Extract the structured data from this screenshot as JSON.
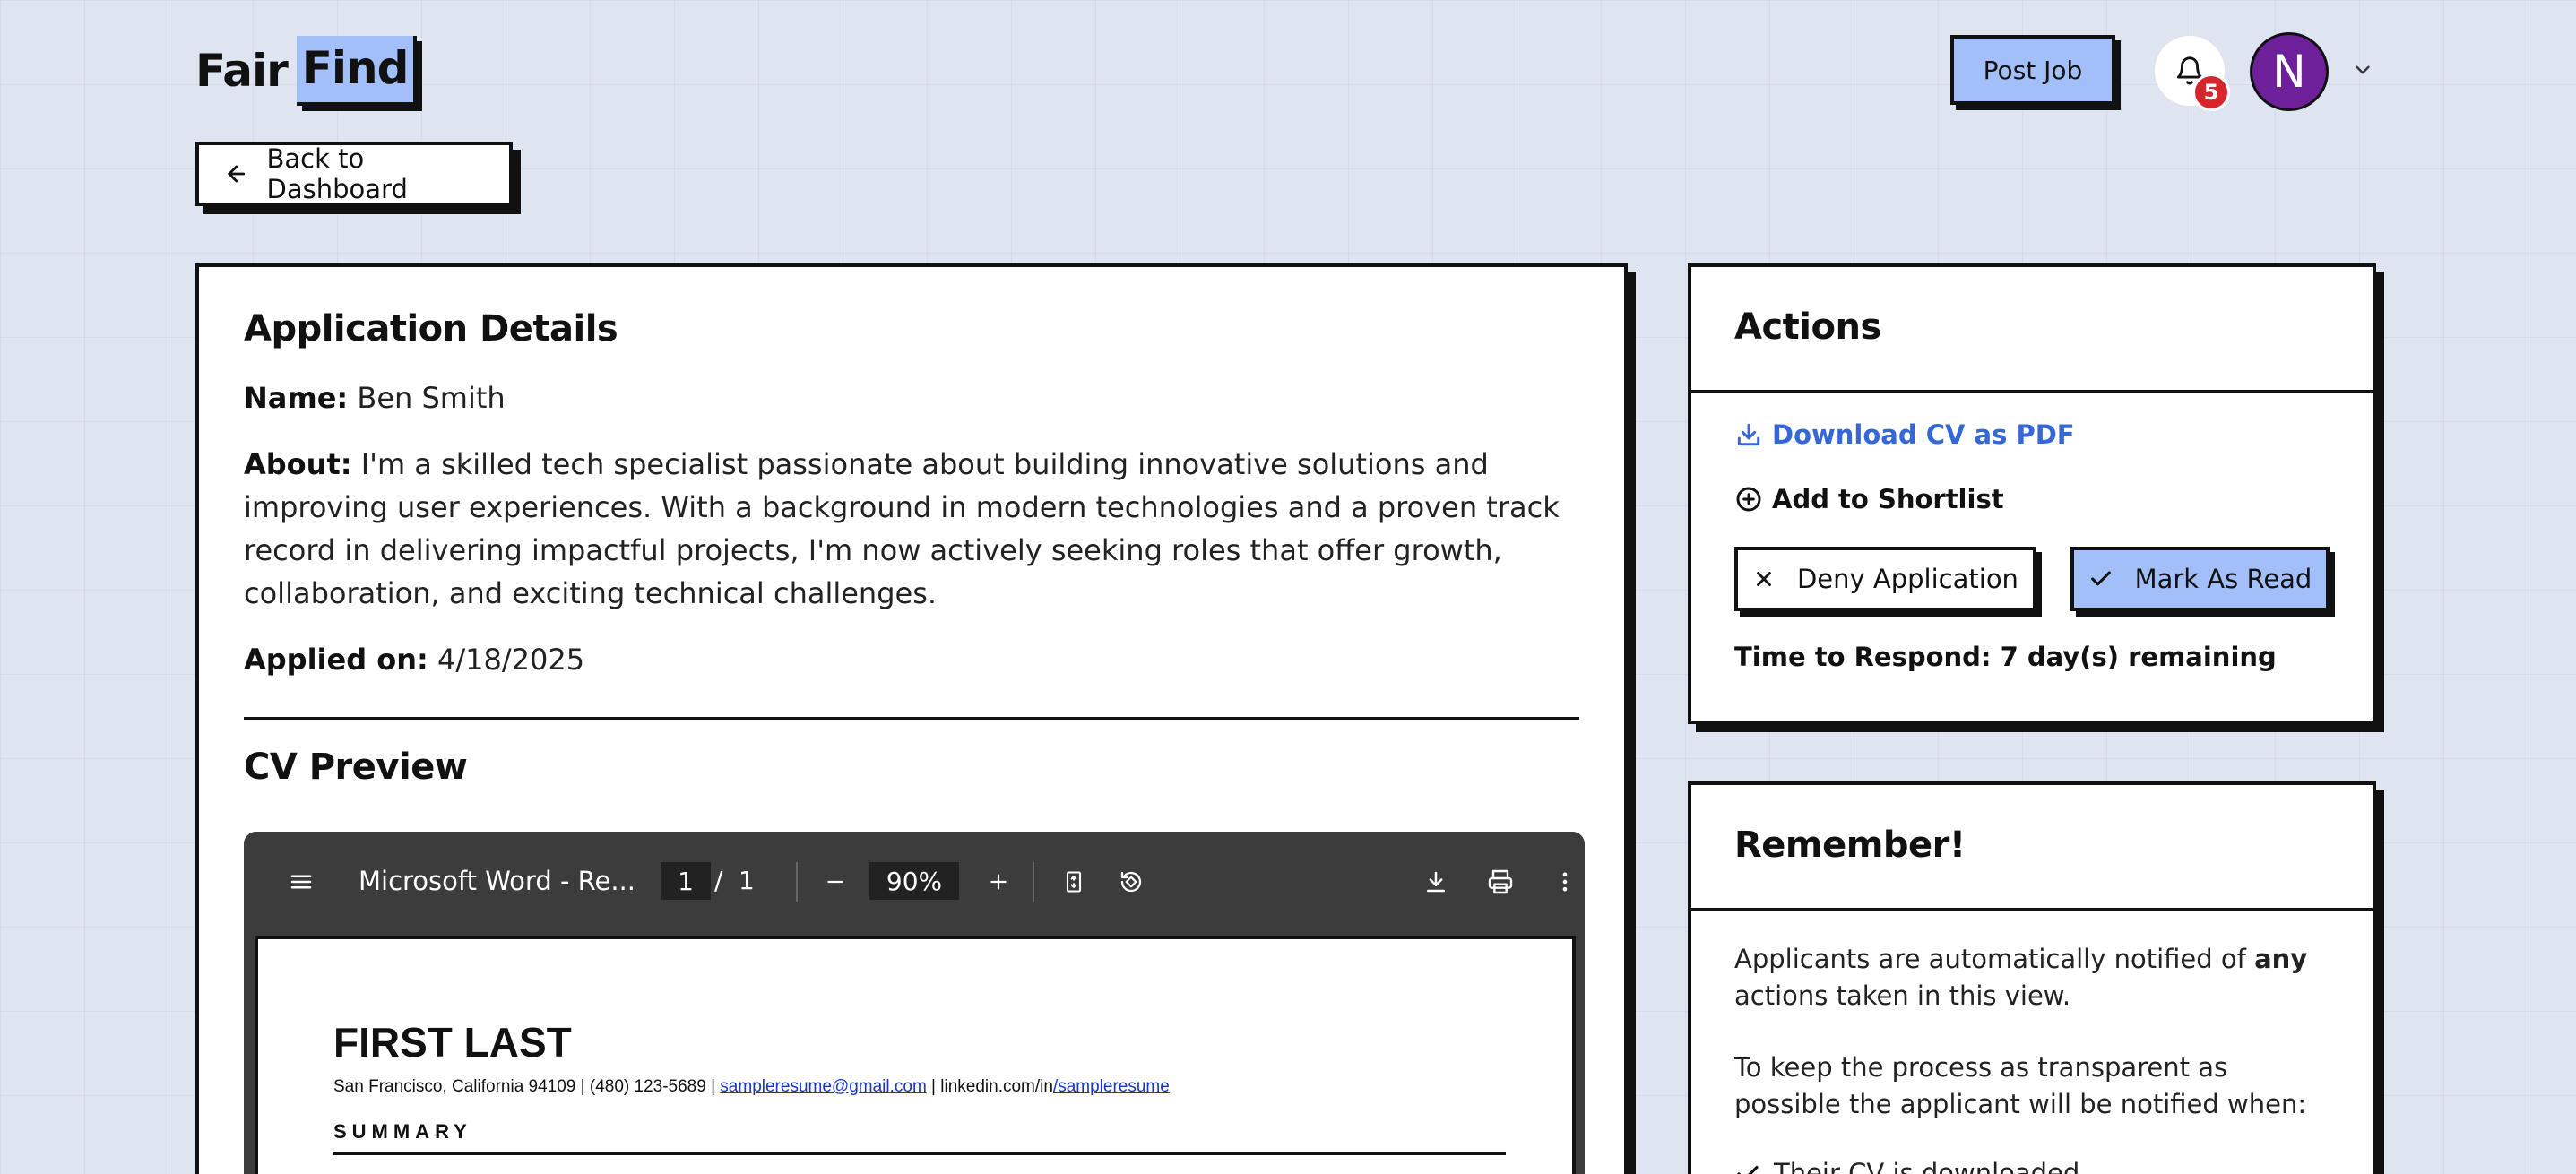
{
  "header": {
    "logo_part1": "Fair",
    "logo_part2": "Find",
    "post_job_label": "Post Job",
    "notification_count": "5",
    "avatar_initial": "N"
  },
  "back_button": {
    "label": "Back to Dashboard"
  },
  "application": {
    "title": "Application Details",
    "name_label": "Name:",
    "name_value": "Ben Smith",
    "about_label": "About:",
    "about_value": "I'm a skilled tech specialist passionate about building innovative solutions and improving user experiences. With a background in modern technologies and a proven track record in delivering impactful projects, I'm now actively seeking roles that offer growth, collaboration, and exciting technical challenges.",
    "applied_label": "Applied on:",
    "applied_value": "4/18/2025",
    "cv_preview_title": "CV Preview"
  },
  "pdf_viewer": {
    "doc_title": "Microsoft Word - Re...",
    "current_page": "1",
    "page_separator": "/",
    "total_pages": "1",
    "zoom": "90%",
    "resume": {
      "name": "FIRST LAST",
      "contact_prefix": "San Francisco, California 94109 | (480) 123-5689 |",
      "email": "sampleresume@gmail.com",
      "linkedin_prefix": "| linkedin.com/in",
      "linkedin_link": "/sampleresume",
      "section": "SUMMARY"
    }
  },
  "actions": {
    "title": "Actions",
    "download_label": "Download CV as PDF",
    "shortlist_label": "Add to Shortlist",
    "deny_label": "Deny Application",
    "mark_read_label": "Mark As Read",
    "time_to_respond": "Time to Respond: 7 day(s) remaining"
  },
  "remember": {
    "title": "Remember!",
    "p1_before": "Applicants are automatically notified of",
    "p1_bold": "any",
    "p1_after": "actions taken in this view.",
    "p2": "To keep the process as transparent as possible the applicant will be notified when:",
    "list_item_1": "Their CV is downloaded"
  },
  "colors": {
    "accent": "#a3bff9",
    "link": "#3568d6",
    "badge": "#d7262b",
    "avatar": "#6e1f9a",
    "background": "#dfe4f1"
  }
}
